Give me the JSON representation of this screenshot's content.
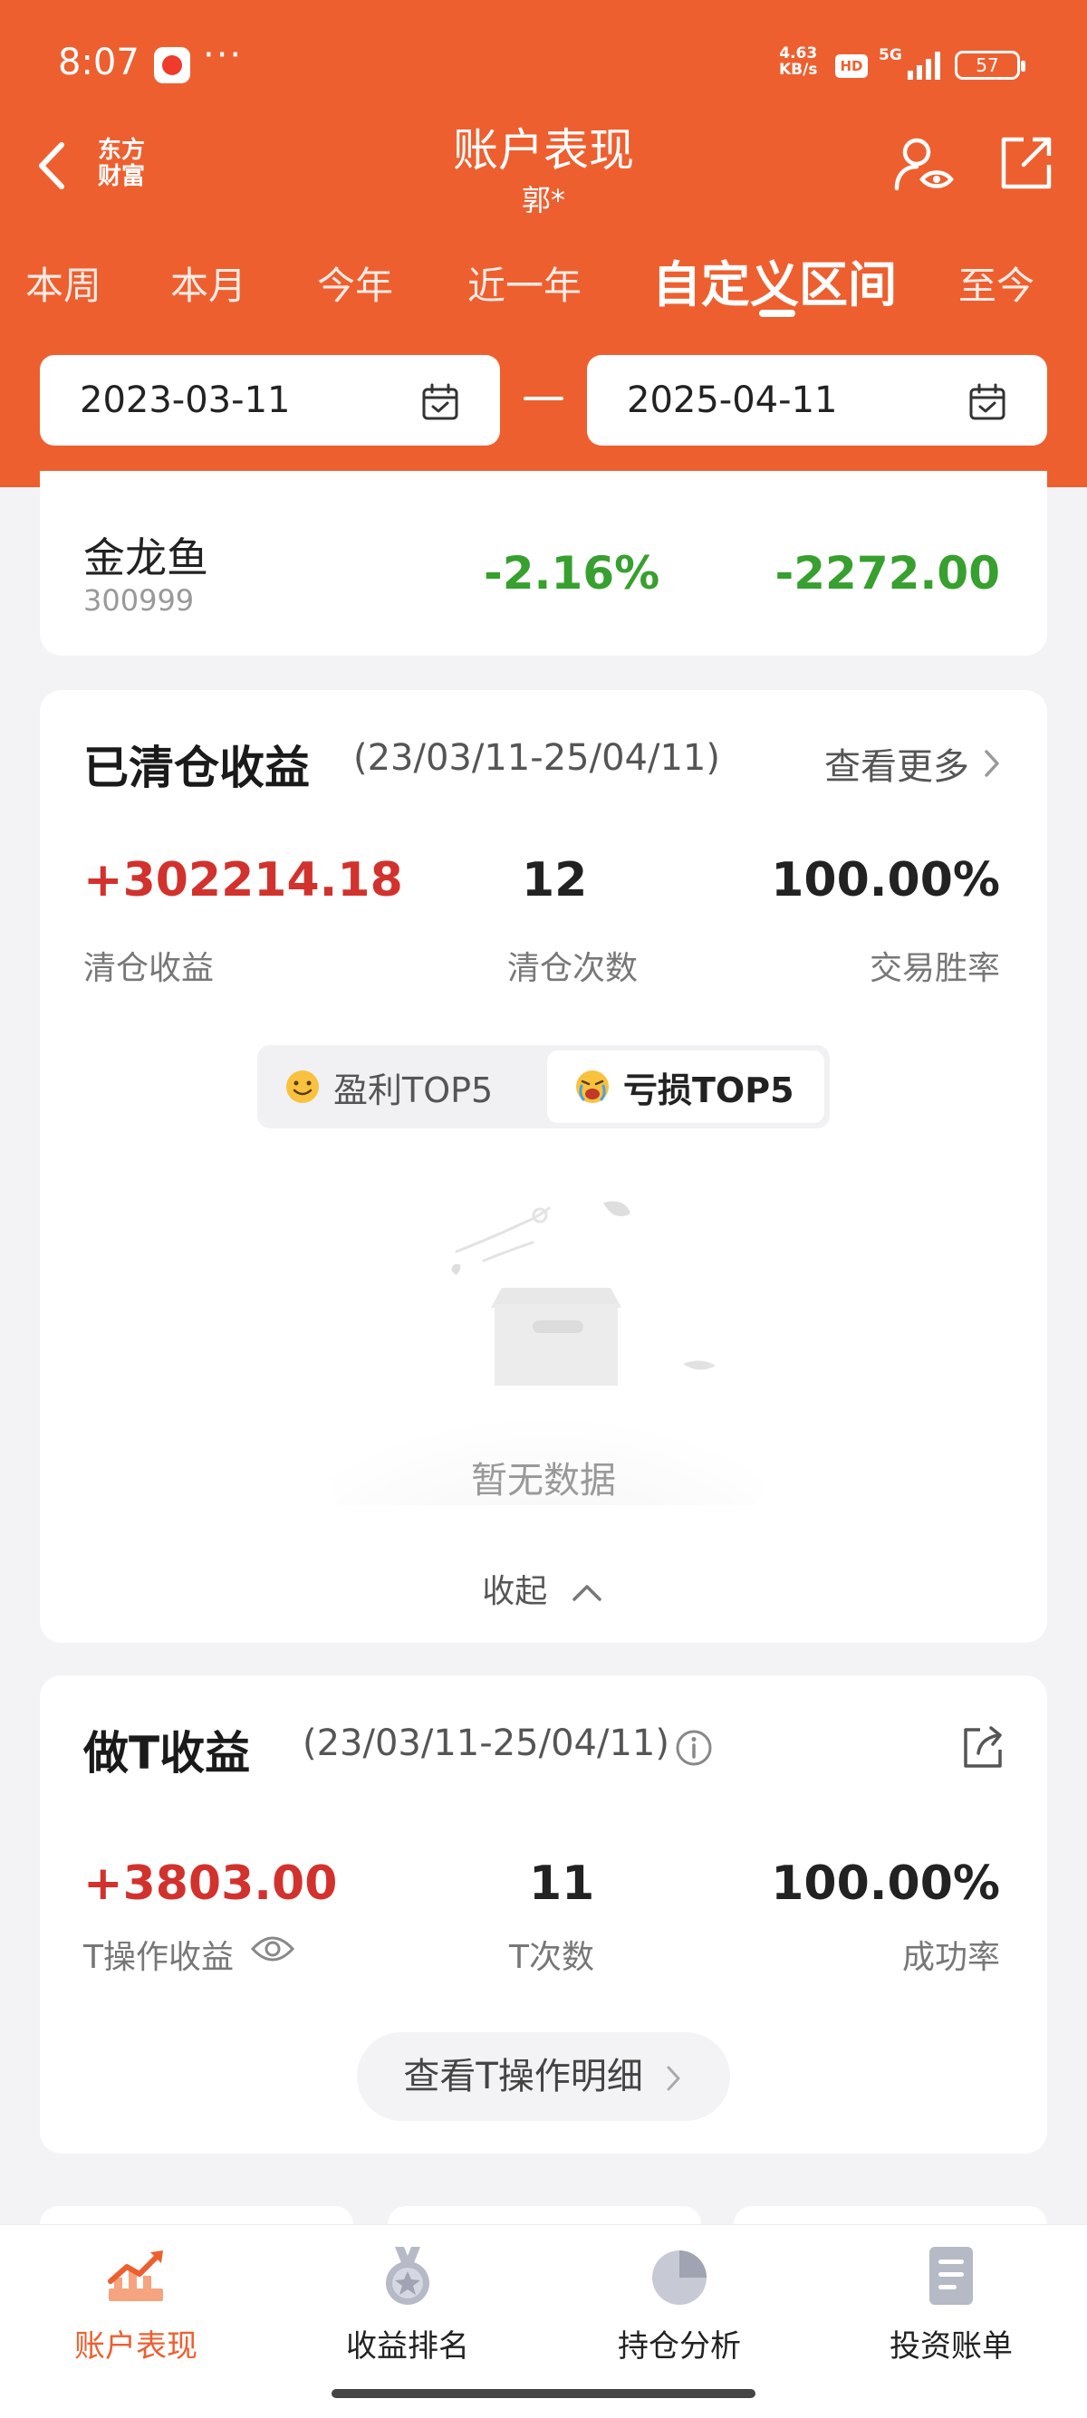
{
  "status_bar": {
    "time": "8:07",
    "dots": "···",
    "speed_value": "4.63",
    "speed_unit": "KB/s",
    "hd": "HD",
    "network": "5G",
    "battery": "57"
  },
  "header": {
    "title": "账户表现",
    "subtitle": "郭*",
    "brand_logo_lines": [
      "东方",
      "财富"
    ],
    "colors": {
      "accent": "#ee5f2f"
    }
  },
  "tabs": [
    {
      "label": "本周",
      "active": false
    },
    {
      "label": "本月",
      "active": false
    },
    {
      "label": "今年",
      "active": false
    },
    {
      "label": "近一年",
      "active": false
    },
    {
      "label": "自定义区间",
      "active": true
    },
    {
      "label": "至今",
      "active": false
    }
  ],
  "date_range": {
    "start": "2023-03-11",
    "end": "2025-04-11"
  },
  "holding_row": {
    "name": "金龙鱼",
    "code": "300999",
    "pct": "-2.16%",
    "amount": "-2272.00"
  },
  "cleared": {
    "title": "已清仓收益",
    "range": "(23/03/11-25/04/11)",
    "view_more": "查看更多",
    "stats": [
      {
        "value": "+302214.18",
        "label": "清仓收益"
      },
      {
        "value": "12",
        "label": "清仓次数"
      },
      {
        "value": "100.00%",
        "label": "交易胜率"
      }
    ],
    "toggle": {
      "profit": "盈利TOP5",
      "loss": "亏损TOP5",
      "selected": "loss"
    },
    "empty_text": "暂无数据",
    "collapse": "收起"
  },
  "t_trade": {
    "title": "做T收益",
    "range": "(23/03/11-25/04/11)",
    "stats": [
      {
        "value": "+3803.00",
        "label": "T操作收益"
      },
      {
        "value": "11",
        "label": "T次数"
      },
      {
        "value": "100.00%",
        "label": "成功率"
      }
    ],
    "detail_button": "查看T操作明细"
  },
  "bottom_nav": [
    {
      "label": "账户表现",
      "icon": "trend-chart-icon",
      "active": true
    },
    {
      "label": "收益排名",
      "icon": "medal-icon",
      "active": false
    },
    {
      "label": "持仓分析",
      "icon": "pie-chart-icon",
      "active": false
    },
    {
      "label": "投资账单",
      "icon": "bill-icon",
      "active": false
    }
  ]
}
